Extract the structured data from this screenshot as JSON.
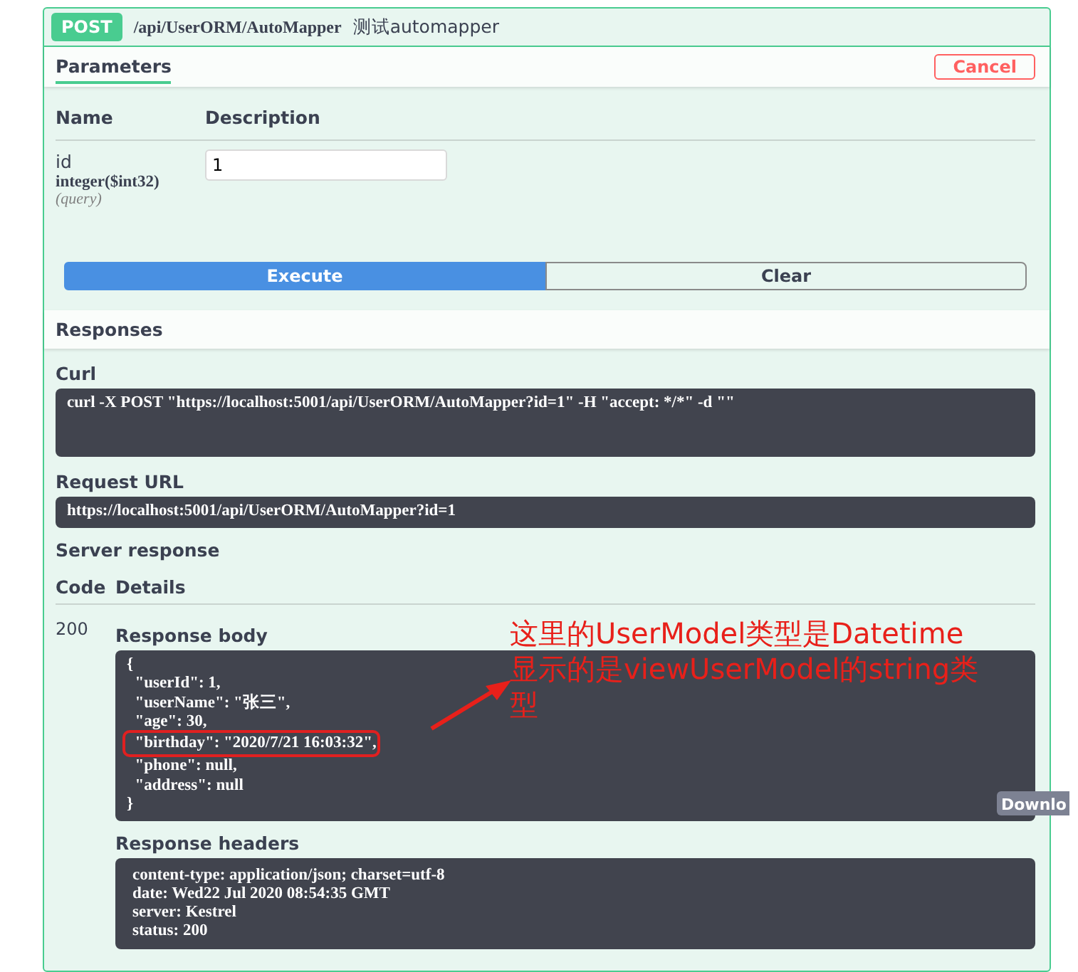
{
  "operation": {
    "method": "POST",
    "path": "/api/UserORM/AutoMapper",
    "summary": "测试automapper"
  },
  "parameters": {
    "title": "Parameters",
    "cancel": "Cancel",
    "columns": [
      "Name",
      "Description"
    ],
    "items": [
      {
        "name": "id",
        "type": "integer($int32)",
        "location": "(query)",
        "value": "1"
      }
    ]
  },
  "actions": [
    {
      "label": "Execute",
      "kind": "primary"
    },
    {
      "label": "Clear",
      "kind": "secondary"
    }
  ],
  "responses": {
    "title": "Responses",
    "curl_label": "Curl",
    "curl": "curl -X POST \"https://localhost:5001/api/UserORM/AutoMapper?id=1\" -H \"accept: */*\" -d \"\"",
    "request_url_label": "Request URL",
    "request_url": "https://localhost:5001/api/UserORM/AutoMapper?id=1",
    "server_response_label": "Server response",
    "columns": [
      "Code",
      "Details"
    ],
    "code": "200",
    "body_label": "Response body",
    "body_lines": [
      {
        "text": "{",
        "highlighted": false
      },
      {
        "text": "  \"userId\": 1,",
        "highlighted": false
      },
      {
        "text": "  \"userName\": \"张三\",",
        "highlighted": false
      },
      {
        "text": "  \"age\": 30,",
        "highlighted": false
      },
      {
        "text": "  \"birthday\": \"2020/7/21 16:03:32\",",
        "highlighted": true
      },
      {
        "text": "  \"phone\": null,",
        "highlighted": false
      },
      {
        "text": "  \"address\": null",
        "highlighted": false
      },
      {
        "text": "}",
        "highlighted": false
      }
    ],
    "download": "Downlo",
    "headers_label": "Response headers",
    "headers_lines": [
      "content-type: application/json; charset=utf-8",
      "date: Wed22 Jul 2020 08:54:35 GMT",
      "server: Kestrel",
      "status: 200"
    ]
  },
  "annotation": {
    "lines": [
      "这里的UserModel类型是Datetime",
      "显示的是viewUserModel的string类型"
    ]
  }
}
